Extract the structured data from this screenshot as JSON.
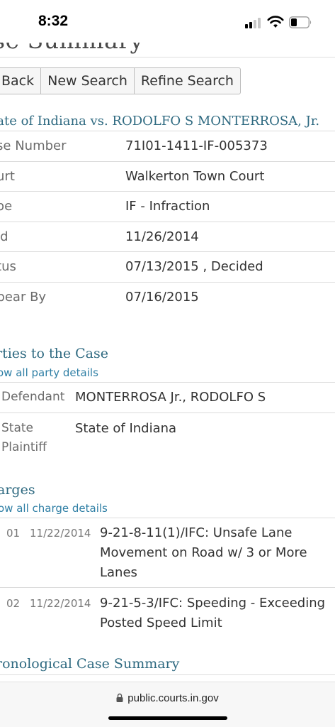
{
  "status_bar": {
    "time": "8:32"
  },
  "page": {
    "title": "ase Summary",
    "buttons": [
      "Back",
      "New Search",
      "Refine Search"
    ],
    "case_heading": "tate of Indiana vs. RODOLFO S MONTERROSA, Jr.",
    "details": [
      {
        "label": "ase Number",
        "value": "71I01-1411-IF-005373"
      },
      {
        "label": "ourt",
        "value": "Walkerton Town Court"
      },
      {
        "label": "ype",
        "value": "IF - Infraction"
      },
      {
        "label": "led",
        "value": "11/26/2014"
      },
      {
        "label": "atus",
        "value": "07/13/2015 , Decided"
      },
      {
        "label": "ppear By",
        "value": "07/16/2015"
      }
    ]
  },
  "parties": {
    "heading": "rties to the Case",
    "link": "ow all party details",
    "rows": [
      {
        "type": "Defendant",
        "name": "MONTERROSA Jr., RODOLFO S"
      },
      {
        "type_line1": "State",
        "type_line2": "Plaintiff",
        "name": "State of Indiana"
      }
    ]
  },
  "charges": {
    "heading": "arges",
    "link": "ow all charge details",
    "rows": [
      {
        "num": "01",
        "date": "11/22/2014",
        "desc": "9-21-8-11(1)/IFC: Unsafe Lane Movement on Road w/ 3 or More Lanes"
      },
      {
        "num": "02",
        "date": "11/22/2014",
        "desc": "9-21-5-3/IFC: Speeding - Exceeding Posted Speed Limit"
      }
    ]
  },
  "chronological": {
    "heading": "ronological Case Summary"
  },
  "url_bar": {
    "url": "public.courts.in.gov"
  },
  "colors": {
    "heading": "#2f6a81",
    "link": "#2f7fa5",
    "divider": "#dcdcdc"
  },
  "icons": [
    "cellular-signal-icon",
    "wifi-icon",
    "battery-icon",
    "lock-icon"
  ]
}
